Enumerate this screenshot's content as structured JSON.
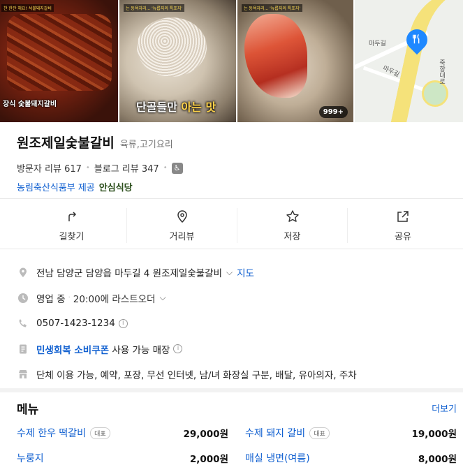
{
  "photos": {
    "p1_tag": "찬 한잔 해요! 석불돼지갈비",
    "p1_caption": "장식 숯불돼지갈비",
    "p2_tag": "는 동욕자리... '뉴롭지의 특포지'",
    "p2_subtitle_part1": "단골들만 ",
    "p2_subtitle_highlight": "아는 맛",
    "p3_tag": "는 동욕자리... '뉴롭지의 특포지'",
    "p3_count": "999+",
    "map_labels": [
      "마두길",
      "마두길",
      "죽향대로"
    ]
  },
  "place": {
    "name": "원조제일숯불갈비",
    "category": "육류,고기요리",
    "visitor_reviews": "방문자 리뷰 617",
    "blog_reviews": "블로그 리뷰 347",
    "cert_text": "농림축산식품부 제공",
    "cert_badge": "안심식당"
  },
  "actions": [
    {
      "label": "길찾기",
      "icon": "directions-icon"
    },
    {
      "label": "거리뷰",
      "icon": "street-view-icon"
    },
    {
      "label": "저장",
      "icon": "star-icon"
    },
    {
      "label": "공유",
      "icon": "share-icon"
    }
  ],
  "details": {
    "address": "전남 담양군 담양읍 마두길 4 원조제일숯불갈비",
    "map_link": "지도",
    "status": "영업 중",
    "hours": "20:00에 라스트오더",
    "phone": "0507-1423-1234",
    "coupon": "민생회복 소비쿠폰",
    "coupon_suffix": " 사용 가능 매장",
    "facilities": "단체 이용 가능, 예약, 포장, 무선 인터넷, 남/녀 화장실 구분, 배달, 유아의자, 주차"
  },
  "menu": {
    "title": "메뉴",
    "more": "더보기",
    "rep_label": "대표",
    "items": [
      {
        "name": "수제 한우 떡갈비",
        "price": "29,000원",
        "rep": true
      },
      {
        "name": "수제 돼지 갈비",
        "price": "19,000원",
        "rep": true
      },
      {
        "name": "누룽지",
        "price": "2,000원",
        "rep": false
      },
      {
        "name": "매실 냉면(여름)",
        "price": "8,000원",
        "rep": false
      }
    ]
  }
}
